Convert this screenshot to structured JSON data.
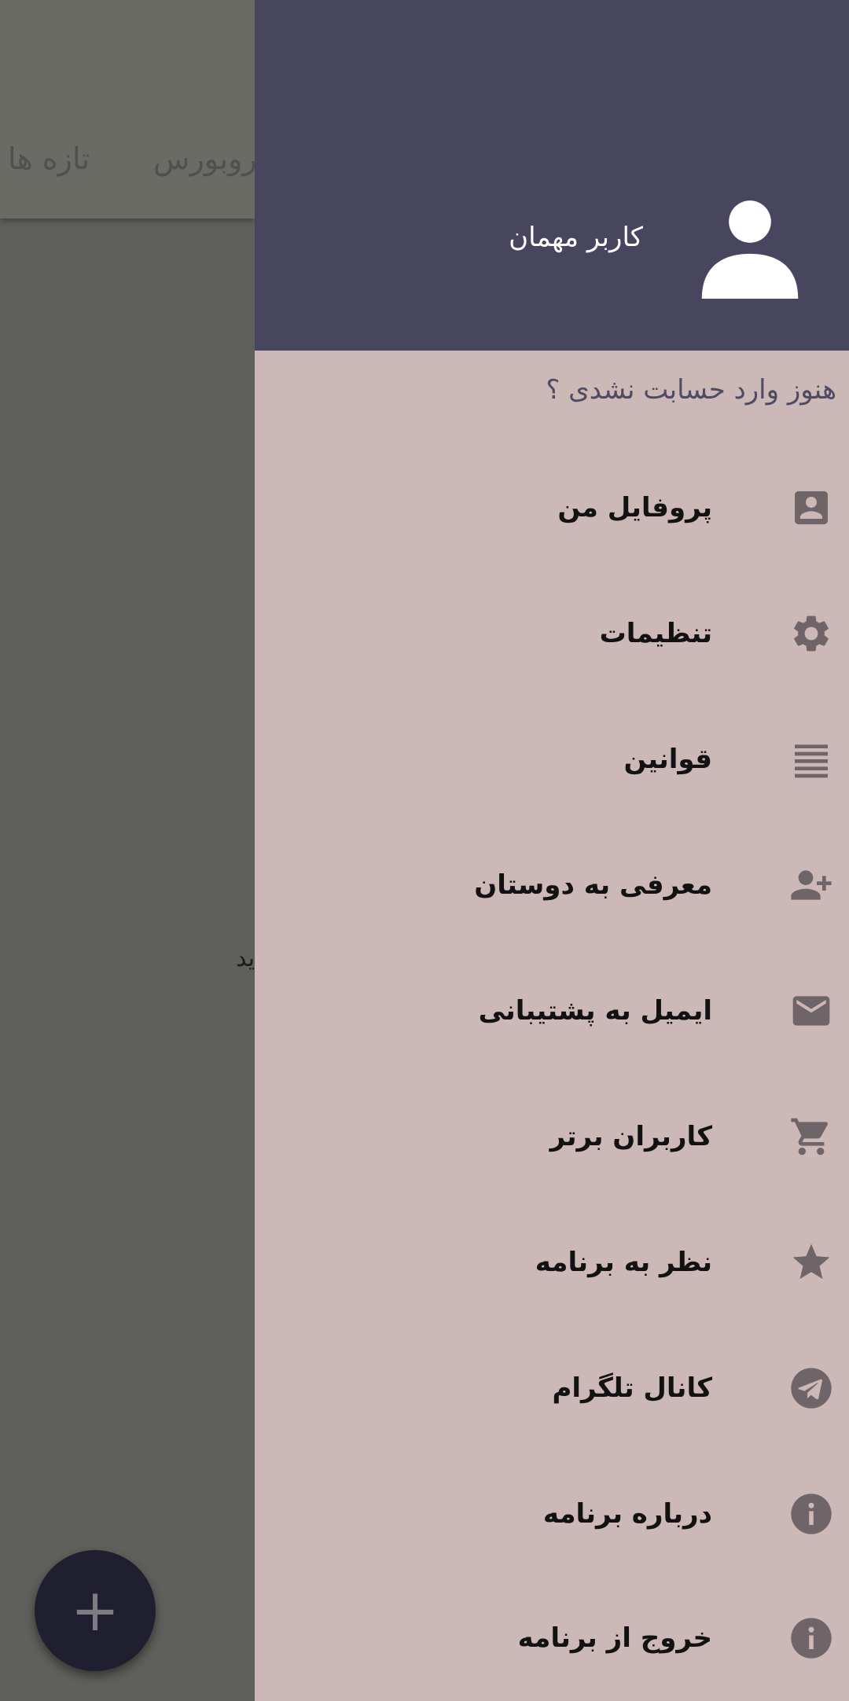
{
  "background": {
    "tabs": [
      "تازه ها",
      "روبورس"
    ],
    "fragment_text": "ید",
    "fab_label": "+"
  },
  "drawer": {
    "user_name": "کاربر مهمان",
    "login_prompt": "هنوز وارد حسابت نشدی ؟",
    "items": [
      {
        "label": "پروفایل من",
        "icon": "account-box-icon"
      },
      {
        "label": "تنظیمات",
        "icon": "gear-icon"
      },
      {
        "label": "قوانین",
        "icon": "text-lines-icon"
      },
      {
        "label": "معرفی به دوستان",
        "icon": "person-add-icon"
      },
      {
        "label": "ایمیل به پشتیبانی",
        "icon": "mail-icon"
      },
      {
        "label": "کاربران برتر",
        "icon": "cart-icon"
      },
      {
        "label": "نظر به برنامه",
        "icon": "star-icon"
      },
      {
        "label": "کانال تلگرام",
        "icon": "telegram-icon"
      },
      {
        "label": "درباره برنامه",
        "icon": "info-icon"
      },
      {
        "label": "خروج از برنامه",
        "icon": "info-icon"
      }
    ]
  },
  "colors": {
    "header": "#48455e",
    "drawer_bg": "#ccb8b6",
    "icon": "#6f6468",
    "fab": "#201f2f"
  }
}
